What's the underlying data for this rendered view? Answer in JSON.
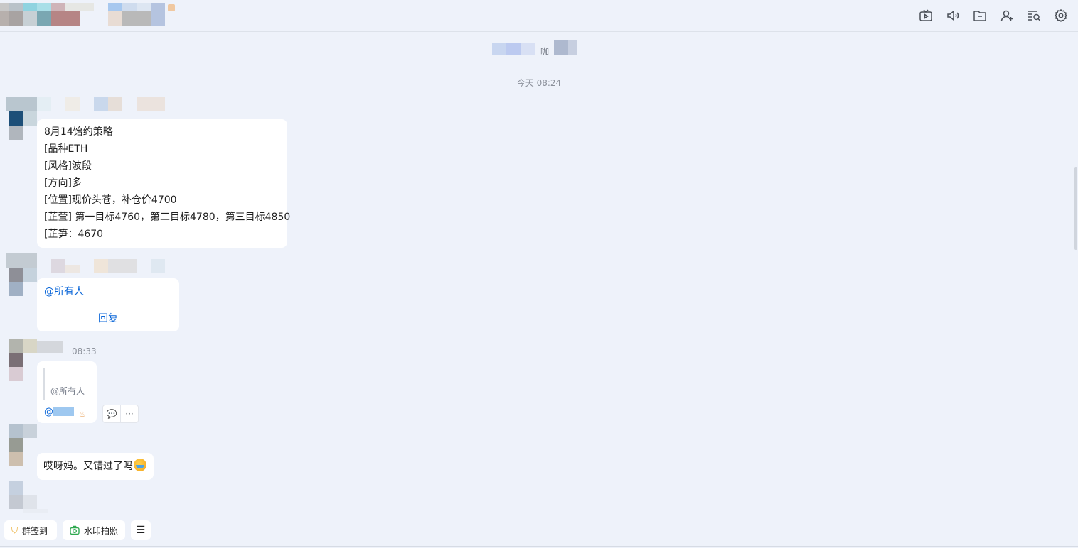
{
  "header": {
    "toolbar": [
      {
        "name": "video-icon",
        "label": "视频"
      },
      {
        "name": "speaker-icon",
        "label": "语音"
      },
      {
        "name": "folder-icon",
        "label": "文件"
      },
      {
        "name": "add-member-icon",
        "label": "添加成员"
      },
      {
        "name": "search-history-icon",
        "label": "查找记录"
      },
      {
        "name": "settings-icon",
        "label": "设置"
      }
    ]
  },
  "system_notice": {
    "text": "咖"
  },
  "time_separator": "今天 08:24",
  "messages": [
    {
      "lines": [
        "8月14饴约策略",
        "[品种ETH",
        "[风格]波段",
        "[方向]多",
        "[位置]现价头苍，补仓价4700",
        "[芷莹] 第一目标4760，第二目标4780，第三目标4850",
        "[芷笋：4670"
      ]
    },
    {
      "mention": "@所有人",
      "reply_label": "回复"
    },
    {
      "time": "08:33",
      "quote_text": "@所有人",
      "at_prefix": "@"
    },
    {
      "text": "哎呀妈。又错过了吗"
    }
  ],
  "hover_actions": {
    "comment": "💬",
    "more": "···"
  },
  "bottom_bar": {
    "checkin_label": "群签到",
    "photo_label": "水印拍照",
    "menu_label": "☰"
  }
}
